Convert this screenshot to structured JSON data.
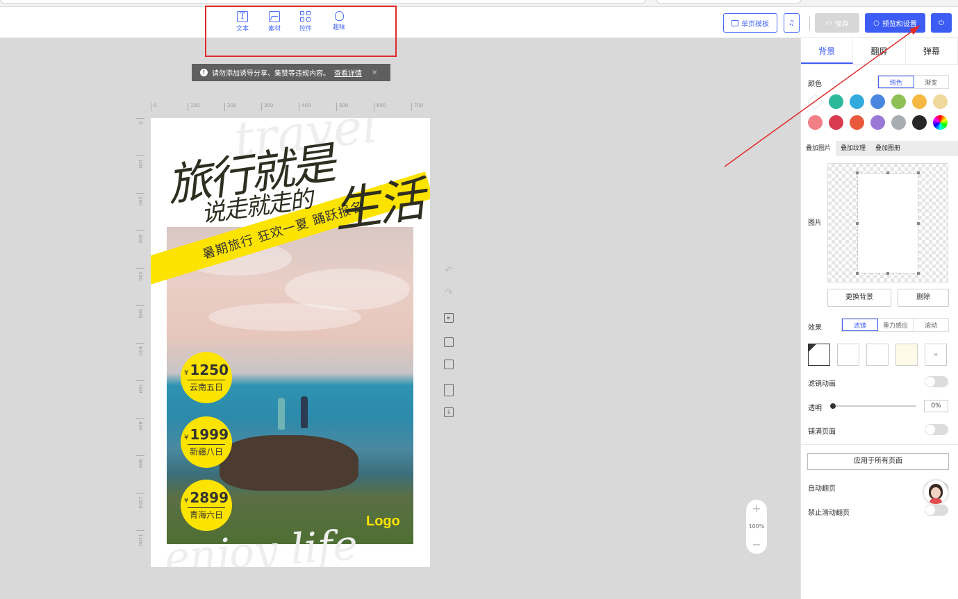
{
  "toolbar": {
    "tools": [
      {
        "label": "文本",
        "icon": "text-icon"
      },
      {
        "label": "素材",
        "icon": "image-icon"
      },
      {
        "label": "控件",
        "icon": "widget-grid-icon"
      },
      {
        "label": "趣味",
        "icon": "bulb-icon"
      }
    ],
    "single_page_template": "单页模板",
    "save": "保存",
    "preview_settings": "预览和设置"
  },
  "notice": {
    "text": "请勿添加诱导分享、集赞等违规内容。",
    "link": "查看详情",
    "close": "×"
  },
  "ruler": {
    "h": [
      "0",
      "100",
      "200",
      "300",
      "400",
      "500",
      "600",
      "700"
    ],
    "v": [
      "0",
      "100",
      "200",
      "300",
      "400",
      "500",
      "600",
      "700",
      "800",
      "900",
      "1000",
      "1100"
    ]
  },
  "poster": {
    "title_line1": "旅行就是",
    "title_line2": "说走就走的",
    "title_big": "生活",
    "banner": "暑期旅行 狂欢一夏 踊跃报名",
    "ghost_top": "travel",
    "ghost_bottom": "enjoy life",
    "prices": [
      {
        "currency": "¥",
        "amount": "1250",
        "trip": "云南五日"
      },
      {
        "currency": "¥",
        "amount": "1999",
        "trip": "新疆八日"
      },
      {
        "currency": "¥",
        "amount": "2899",
        "trip": "青海六日"
      }
    ],
    "logo": "Logo"
  },
  "zoom": {
    "plus": "+",
    "level": "100%",
    "minus": "−"
  },
  "panel": {
    "tabs": [
      "背景",
      "翻屏",
      "弹幕"
    ],
    "color_label": "颜色",
    "color_modes": [
      "纯色",
      "渐变"
    ],
    "swatches_row1": [
      "#ffffff",
      "#2bb99a",
      "#33aadd",
      "#4a86e0",
      "#8dc155",
      "#f5b941",
      "#f0d79b"
    ],
    "swatches_row2": [
      "#f07f86",
      "#d93a4e",
      "#e85a3b",
      "#9a78d6",
      "#a7adb3",
      "#262626",
      "rainbow"
    ],
    "overlay_tabs": [
      "叠加图片",
      "叠加纹理",
      "叠加图册"
    ],
    "image_label": "图片",
    "replace_bg": "更换背景",
    "delete": "删除",
    "effect_label": "效果",
    "effect_modes": [
      "滤镜",
      "重力感应",
      "滚动"
    ],
    "more": "»",
    "filter_anim": "滤镜动画",
    "opacity": "透明",
    "opacity_value": "0%",
    "fill_page": "铺满页面",
    "apply_all": "应用于所有页面",
    "auto_flip": "自动翻页",
    "disable_swipe": "禁止滑动翻页"
  }
}
